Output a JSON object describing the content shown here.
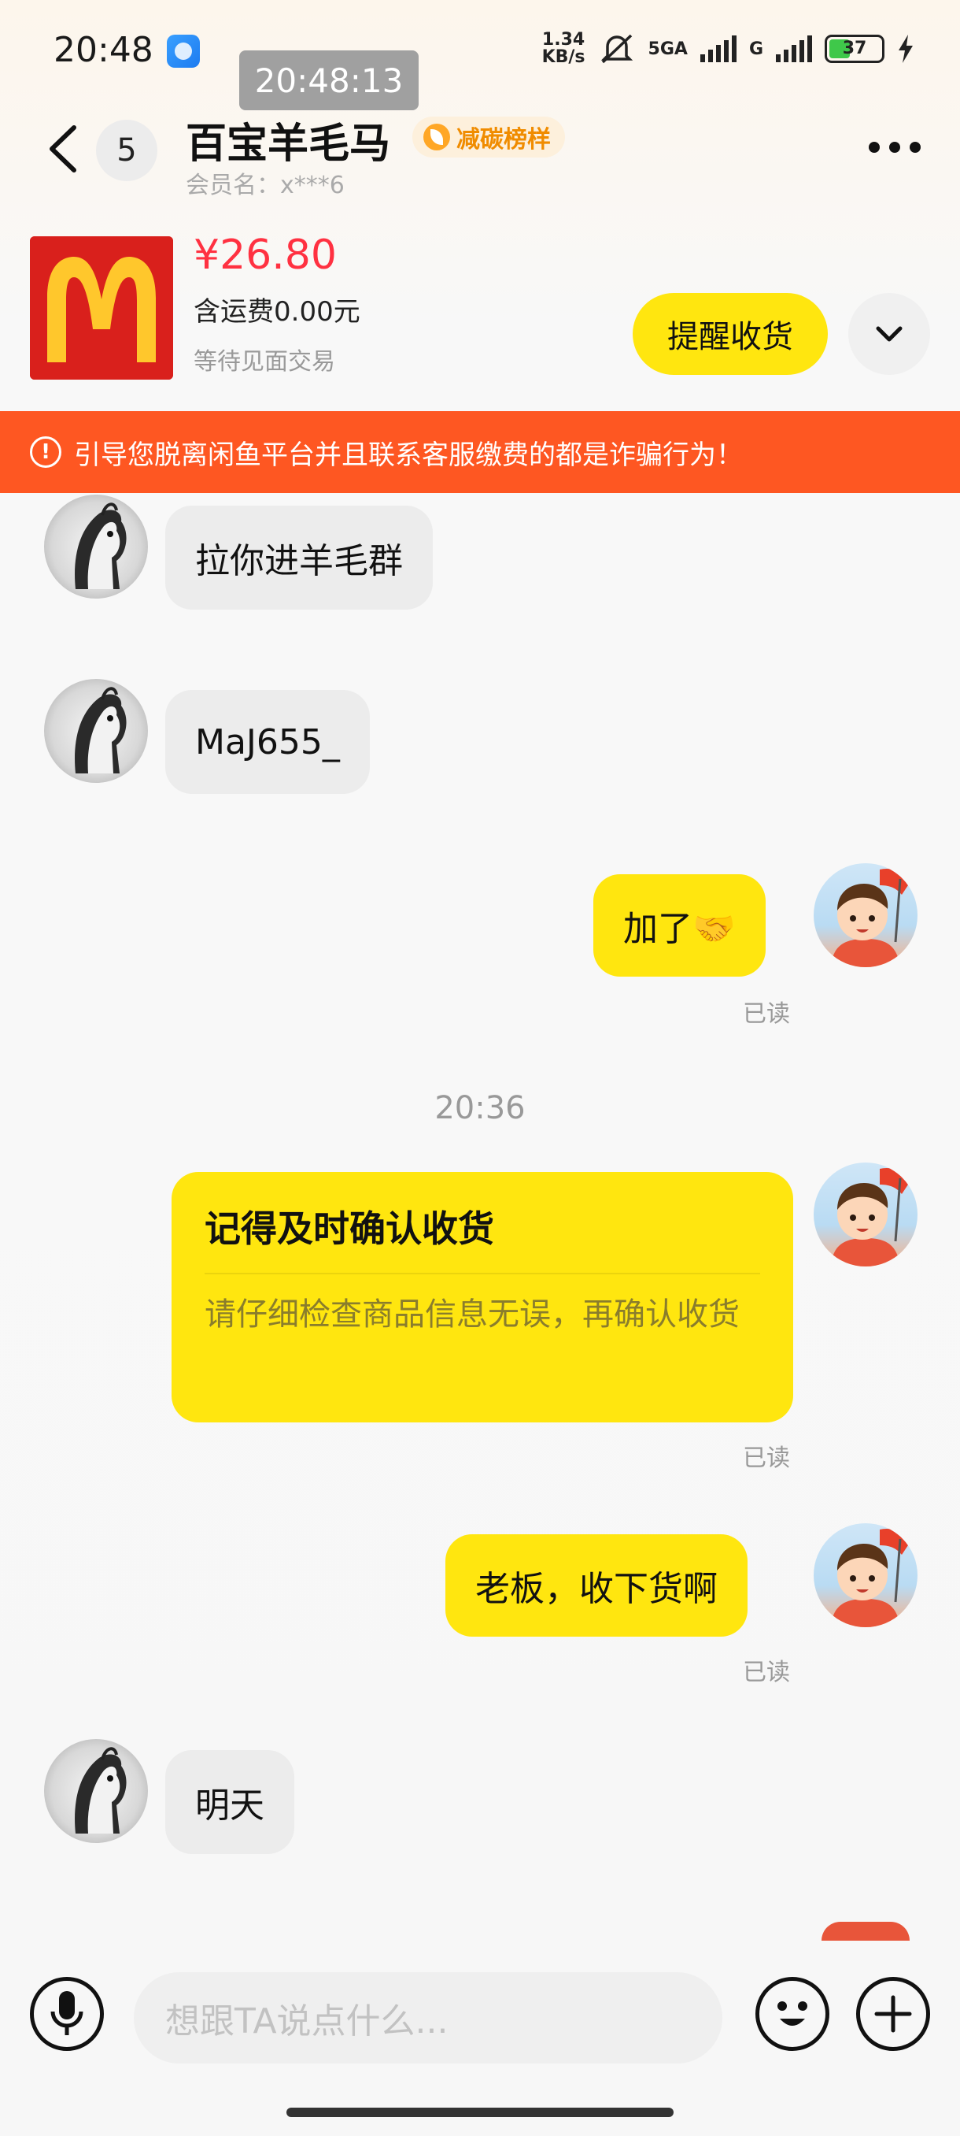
{
  "status_bar": {
    "time": "20:48",
    "net_speed_value": "1.34",
    "net_speed_unit": "KB/s",
    "network_5g": "5GA",
    "network_g": "G",
    "battery": "37"
  },
  "overlay_clock": "20:48:13",
  "header": {
    "unread_count": "5",
    "title": "百宝羊毛马",
    "tag": "减碳榜样",
    "member_label": "会员名：x***6"
  },
  "product": {
    "price": "¥26.80",
    "shipping": "含运费0.00元",
    "status": "等待见面交易",
    "remind_button": "提醒收货"
  },
  "warning": {
    "text": "引导您脱离闲鱼平台并且联系客服缴费的都是诈骗行为！"
  },
  "messages": [
    {
      "side": "in",
      "text": "拉你进羊毛群"
    },
    {
      "side": "in",
      "text": "MaJ655_"
    },
    {
      "side": "out",
      "text": "加了🤝",
      "read": "已读"
    },
    {
      "side": "sep",
      "text": "20:36"
    },
    {
      "side": "out_card",
      "title": "记得及时确认收货",
      "body": "请仔细检查商品信息无误，再确认收货",
      "read": "已读"
    },
    {
      "side": "out",
      "text": "老板，收下货啊",
      "read": "已读"
    },
    {
      "side": "in",
      "text": "明天"
    }
  ],
  "input_bar": {
    "placeholder": "想跟TA说点什么..."
  },
  "icons": {
    "back": "chevron-left-icon",
    "more": "more-dots-icon",
    "expand": "chevron-down-icon",
    "warning": "exclamation-circle-icon",
    "voice": "microphone-icon",
    "emoji": "smile-icon",
    "plus": "plus-icon"
  },
  "colors": {
    "accent_yellow": "#ffe60f",
    "price_red": "#ff3141",
    "warning_orange": "#fe5722",
    "tag_orange": "#f08c00"
  }
}
